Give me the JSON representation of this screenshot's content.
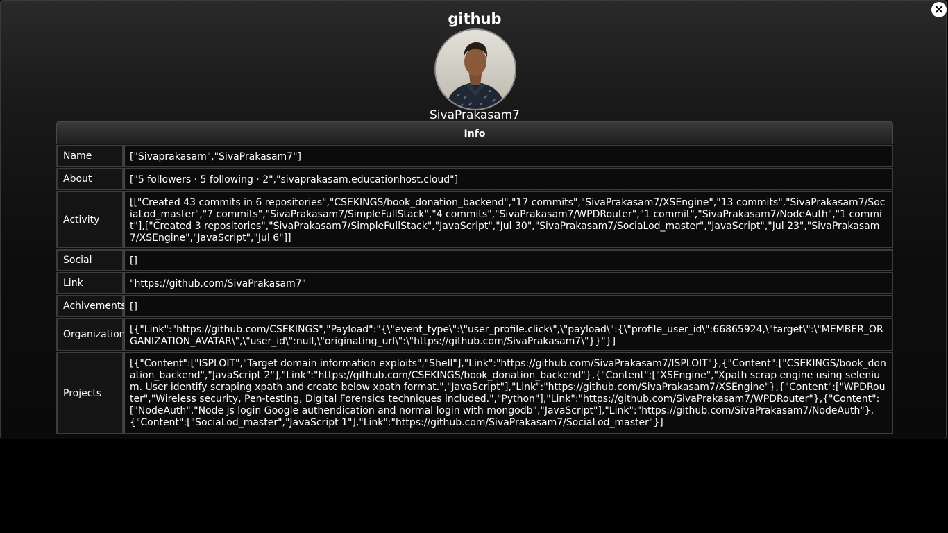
{
  "title": "github",
  "username": "SivaPrakasam7",
  "close_label": "×",
  "info_header": "Info",
  "rows": [
    {
      "label": "Name",
      "value": "[\"Sivaprakasam\",\"SivaPrakasam7\"]"
    },
    {
      "label": "About",
      "value": "[\"5 followers · 5 following · 2\",\"sivaprakasam.educationhost.cloud\"]"
    },
    {
      "label": "Activity",
      "value": "[[\"Created 43 commits in 6 repositories\",\"CSEKINGS/book_donation_backend\",\"17 commits\",\"SivaPrakasam7/XSEngine\",\"13 commits\",\"SivaPrakasam7/SociaLod_master\",\"7 commits\",\"SivaPrakasam7/SimpleFullStack\",\"4 commits\",\"SivaPrakasam7/WPDRouter\",\"1 commit\",\"SivaPrakasam7/NodeAuth\",\"1 commit\"],[\"Created 3 repositories\",\"SivaPrakasam7/SimpleFullStack\",\"JavaScript\",\"Jul 30\",\"SivaPrakasam7/SociaLod_master\",\"JavaScript\",\"Jul 23\",\"SivaPrakasam7/XSEngine\",\"JavaScript\",\"Jul 6\"]]"
    },
    {
      "label": "Social",
      "value": "[]"
    },
    {
      "label": "Link",
      "value": "\"https://github.com/SivaPrakasam7\""
    },
    {
      "label": "Achivements",
      "value": "[]"
    },
    {
      "label": "Organization",
      "value": "[{\"Link\":\"https://github.com/CSEKINGS\",\"Payload\":\"{\\\"event_type\\\":\\\"user_profile.click\\\",\\\"payload\\\":{\\\"profile_user_id\\\":66865924,\\\"target\\\":\\\"MEMBER_ORGANIZATION_AVATAR\\\",\\\"user_id\\\":null,\\\"originating_url\\\":\\\"https://github.com/SivaPrakasam7\\\"}}\"}]"
    },
    {
      "label": "Projects",
      "value": "[{\"Content\":[\"ISPLOIT\",\"Target domain information exploits\",\"Shell\"],\"Link\":\"https://github.com/SivaPrakasam7/ISPLOIT\"},{\"Content\":[\"CSEKINGS/book_donation_backend\",\"JavaScript 2\"],\"Link\":\"https://github.com/CSEKINGS/book_donation_backend\"},{\"Content\":[\"XSEngine\",\"Xpath scrap engine using selenium. User identify scraping xpath and create below xpath format.\",\"JavaScript\"],\"Link\":\"https://github.com/SivaPrakasam7/XSEngine\"},{\"Content\":[\"WPDRouter\",\"Wireless security, Pen-testing, Digital Forensics techniques included.\",\"Python\"],\"Link\":\"https://github.com/SivaPrakasam7/WPDRouter\"},{\"Content\":[\"NodeAuth\",\"Node js login Google authendication and normal login with mongodb\",\"JavaScript\"],\"Link\":\"https://github.com/SivaPrakasam7/NodeAuth\"},{\"Content\":[\"SociaLod_master\",\"JavaScript 1\"],\"Link\":\"https://github.com/SivaPrakasam7/SociaLod_master\"}]"
    }
  ]
}
